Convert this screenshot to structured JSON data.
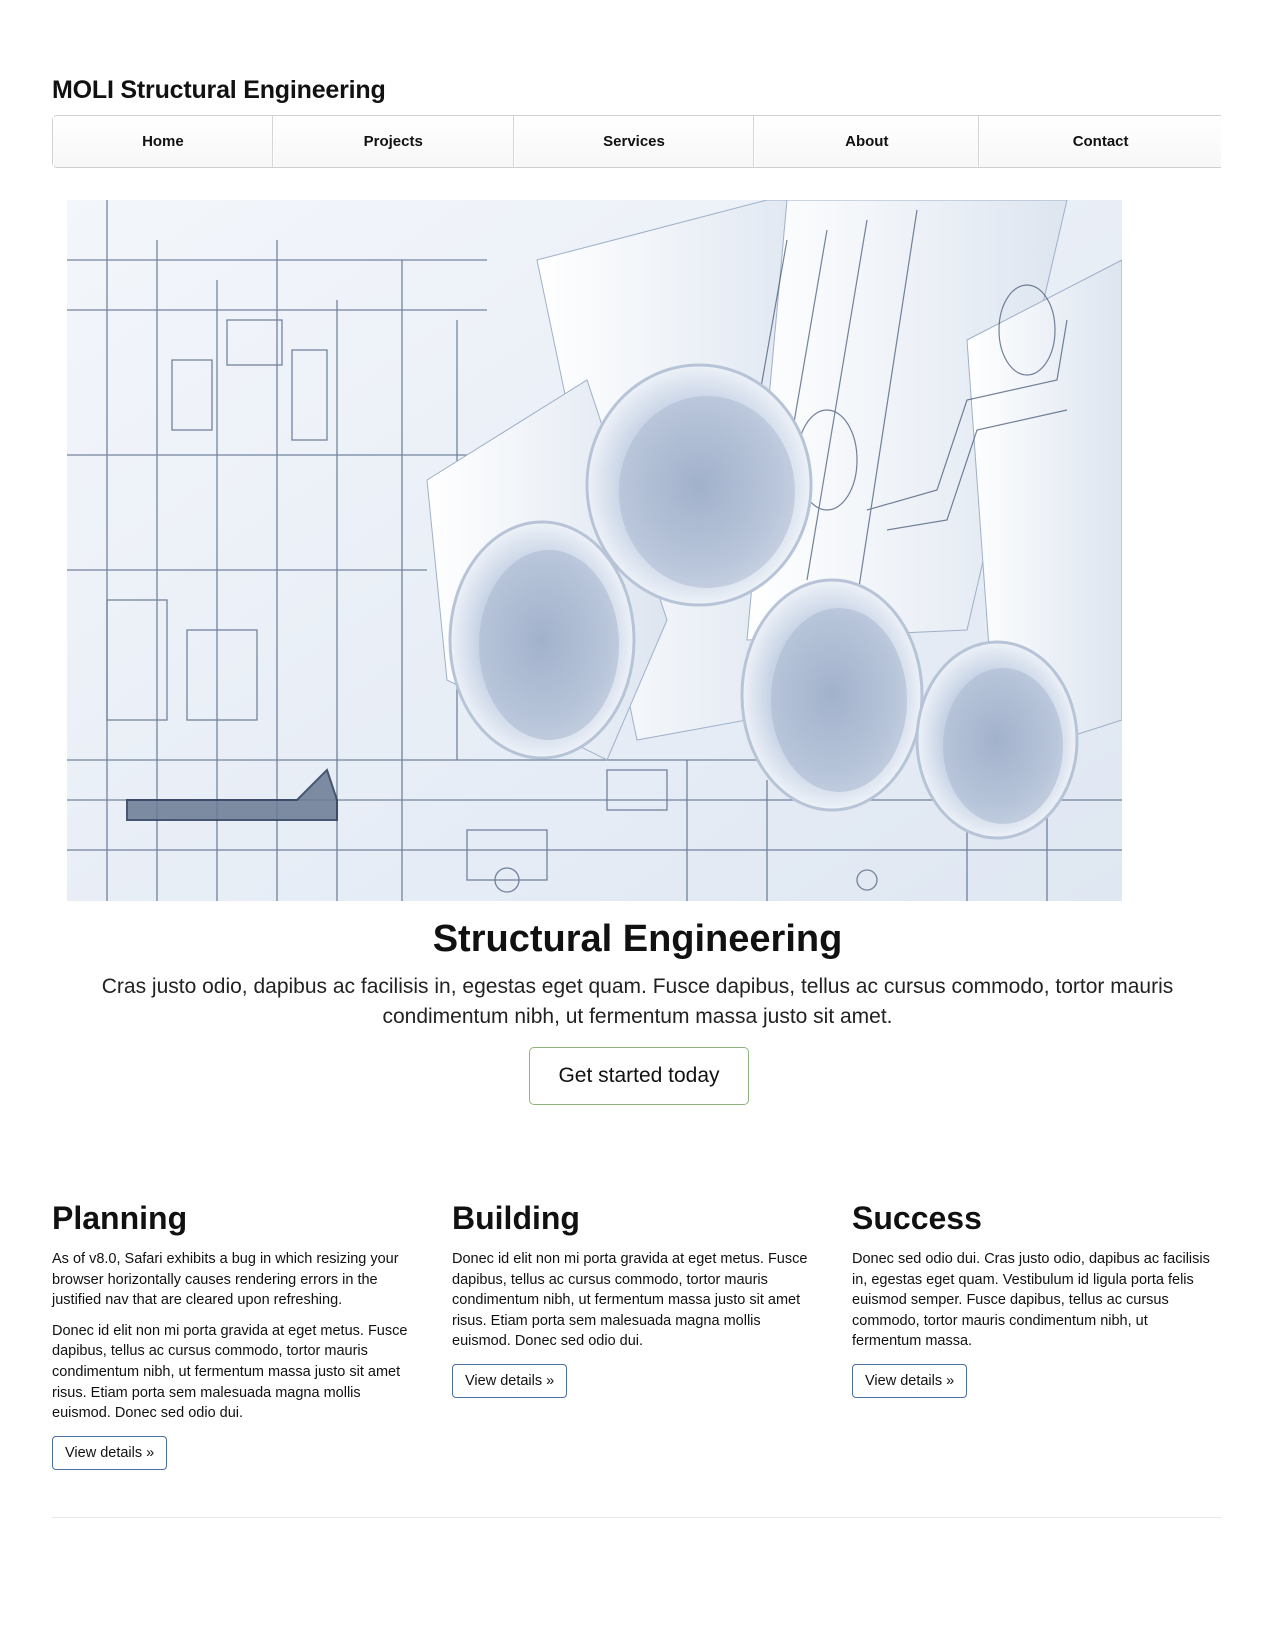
{
  "site": {
    "title": "MOLI Structural Engineering"
  },
  "nav": {
    "items": [
      {
        "label": "Home"
      },
      {
        "label": "Projects"
      },
      {
        "label": "Services"
      },
      {
        "label": "About"
      },
      {
        "label": "Contact"
      }
    ]
  },
  "hero": {
    "image_subject": "rolled blueprint drawings",
    "heading": "Structural Engineering",
    "lead": "Cras justo odio, dapibus ac facilisis in, egestas eget quam. Fusce dapibus, tellus ac cursus commodo, tortor mauris condimentum nibh, ut fermentum massa justo sit amet.",
    "cta_label": "Get started today"
  },
  "columns": [
    {
      "heading": "Planning",
      "paragraphs": [
        "As of v8.0, Safari exhibits a bug in which resizing your browser horizontally causes rendering errors in the justified nav that are cleared upon refreshing.",
        "Donec id elit non mi porta gravida at eget metus. Fusce dapibus, tellus ac cursus commodo, tortor mauris condimentum nibh, ut fermentum massa justo sit amet risus. Etiam porta sem malesuada magna mollis euismod. Donec sed odio dui."
      ],
      "button_label": "View details »"
    },
    {
      "heading": "Building",
      "paragraphs": [
        "Donec id elit non mi porta gravida at eget metus. Fusce dapibus, tellus ac cursus commodo, tortor mauris condimentum nibh, ut fermentum massa justo sit amet risus. Etiam porta sem malesuada magna mollis euismod. Donec sed odio dui."
      ],
      "button_label": "View details »"
    },
    {
      "heading": "Success",
      "paragraphs": [
        "Donec sed odio dui. Cras justo odio, dapibus ac facilisis in, egestas eget quam. Vestibulum id ligula porta felis euismod semper. Fusce dapibus, tellus ac cursus commodo, tortor mauris condimentum nibh, ut fermentum massa."
      ],
      "button_label": "View details »"
    }
  ],
  "colors": {
    "cta_border": "#8fb57d",
    "button_border": "#4a6fa5",
    "blueprint_line": "#2b3d5c",
    "blueprint_paper": "#e9eff7"
  }
}
